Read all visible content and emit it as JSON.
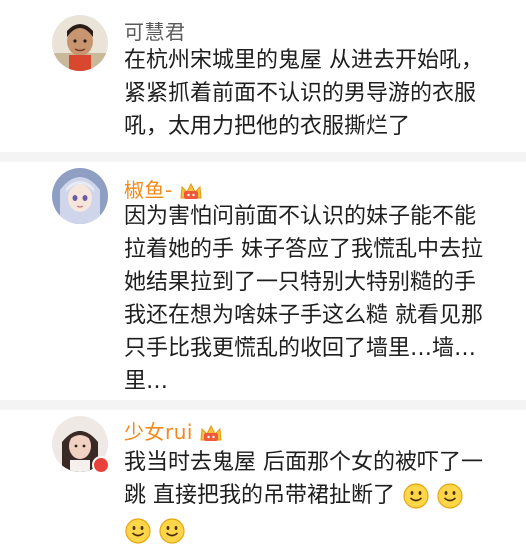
{
  "comments": [
    {
      "username": "可慧君",
      "text_lines": [
        "在杭州宋城里的鬼屋 从进去开始吼，",
        "紧紧抓着前面不认识的男导游的衣服",
        "吼，太用力把他的衣服撕烂了"
      ]
    },
    {
      "username": "椒鱼-",
      "text_lines": [
        "因为害怕问前面不认识的妹子能不能",
        "拉着她的手 妹子答应了我慌乱中去拉",
        "她结果拉到了一只特别大特别糙的手",
        "我还在想为啥妹子手这么糙 就看见那",
        "只手比我更慌乱的收回了墙里…墙…",
        "里…"
      ]
    },
    {
      "username": "少女rui",
      "text_lines": [
        "我当时去鬼屋 后面那个女的被吓了一",
        "跳 直接把我的吊带裙扯断了"
      ]
    }
  ],
  "colors": {
    "vip_name": "#f08a1c",
    "plain_name": "#5a5a5a",
    "divider": "#f4f4f4"
  }
}
